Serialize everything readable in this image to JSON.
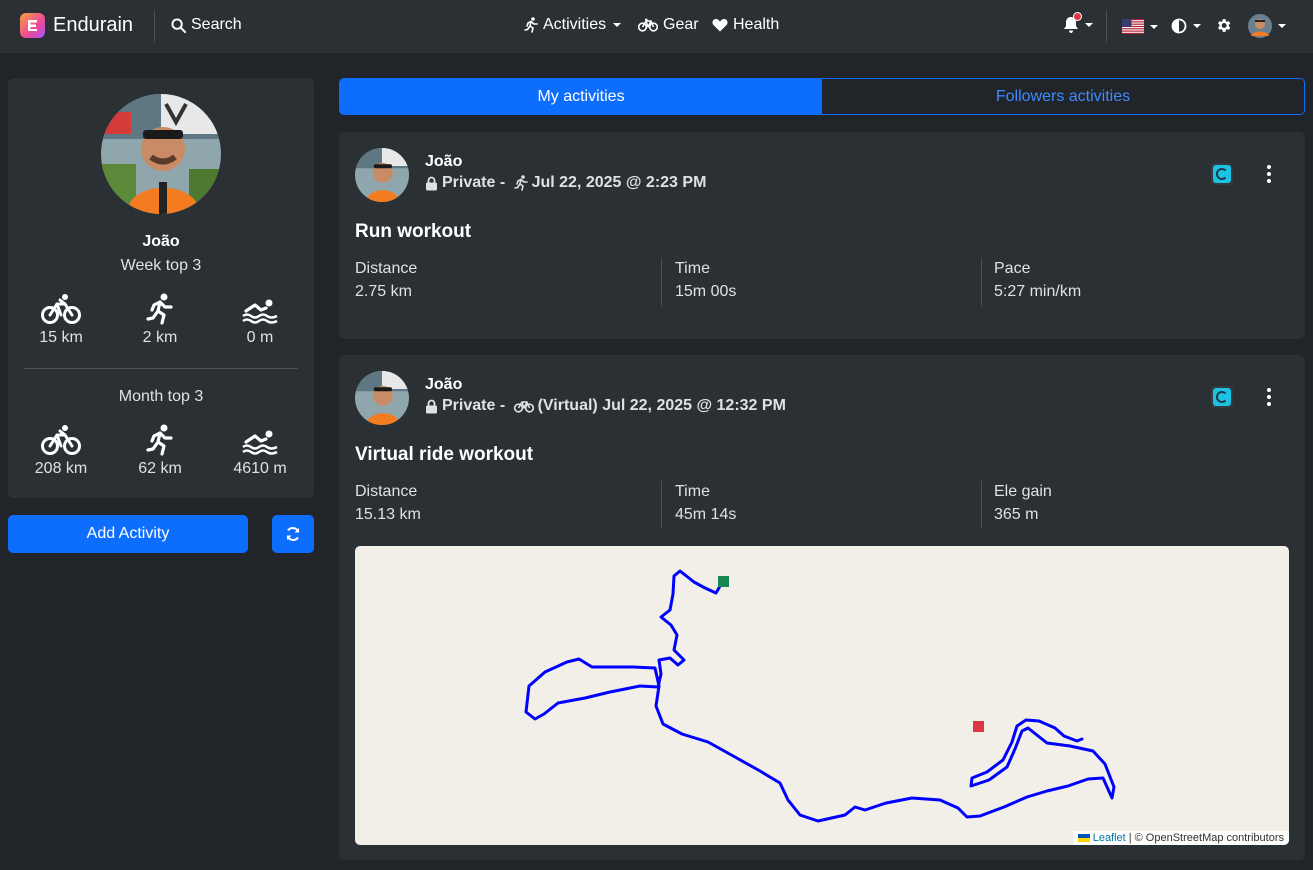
{
  "nav": {
    "brand": "Endurain",
    "search": "Search",
    "activities": "Activities",
    "gear": "Gear",
    "health": "Health"
  },
  "colors": {
    "primary": "#0d6efd",
    "bg": "#212529",
    "card": "#2b3035",
    "route": "#0000ff",
    "start_marker": "#198754",
    "end_marker": "#dc3545"
  },
  "profile": {
    "name": "João",
    "week_title": "Week top 3",
    "month_title": "Month top 3",
    "week": {
      "cycling": "15 km",
      "running": "2 km",
      "swimming": "0 m"
    },
    "month": {
      "cycling": "208 km",
      "running": "62 km",
      "swimming": "4610 m"
    }
  },
  "actions": {
    "add_activity": "Add Activity"
  },
  "tabs": {
    "mine": "My activities",
    "followers": "Followers activities"
  },
  "activities": [
    {
      "user": "João",
      "visibility": "Private - ",
      "sport_icon": "running-icon",
      "datetime": "Jul 22, 2025 @ 2:23 PM",
      "title": "Run workout",
      "metrics": [
        {
          "label": "Distance",
          "value": "2.75 km"
        },
        {
          "label": "Time",
          "value": "15m 00s"
        },
        {
          "label": "Pace",
          "value": "5:27 min/km"
        }
      ]
    },
    {
      "user": "João",
      "visibility": "Private - ",
      "sport_icon": "bike-icon",
      "datetime": "(Virtual) Jul 22, 2025 @ 12:32 PM",
      "title": "Virtual ride workout",
      "metrics": [
        {
          "label": "Distance",
          "value": "15.13 km"
        },
        {
          "label": "Time",
          "value": "45m 14s"
        },
        {
          "label": "Ele gain",
          "value": "365 m"
        }
      ],
      "map": {
        "leaflet": "Leaflet",
        "attribution": "| © OpenStreetMap contributors"
      }
    }
  ]
}
